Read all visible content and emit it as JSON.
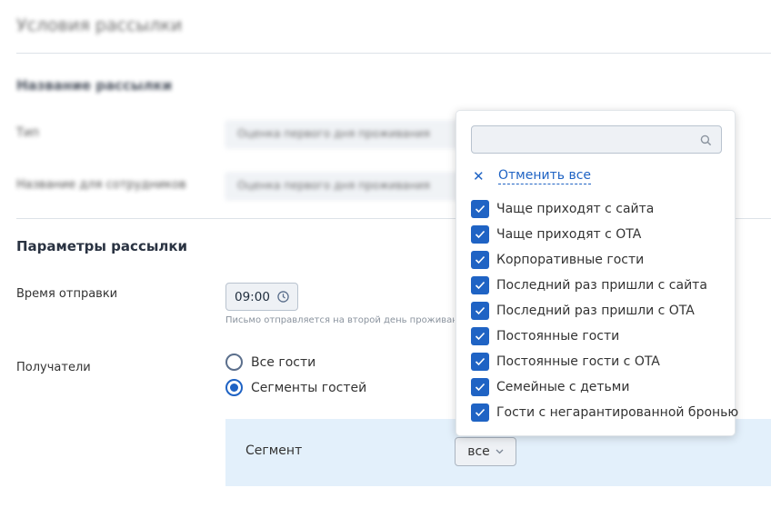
{
  "page": {
    "title": "Условия рассылки"
  },
  "name_section": {
    "heading": "Название рассылки",
    "type_label": "Тип",
    "type_value": "Оценка первого дня проживания",
    "staff_label": "Название для сотрудников",
    "staff_value": "Оценка первого дня проживания"
  },
  "params": {
    "heading": "Параметры рассылки",
    "time_label": "Время отправки",
    "time_value": "09:00",
    "time_hint": "Письмо отправляется на второй день проживания гостя",
    "recipients_label": "Получатели",
    "radio_all": "Все гости",
    "radio_segments": "Сегменты гостей",
    "segment_label": "Сегмент",
    "segment_value": "все"
  },
  "dropdown": {
    "search_placeholder": "",
    "cancel_all": "Отменить все",
    "items": [
      {
        "label": "Чаще приходят с сайта",
        "checked": true
      },
      {
        "label": "Чаще приходят с OTA",
        "checked": true
      },
      {
        "label": "Корпоративные гости",
        "checked": true
      },
      {
        "label": "Последний раз пришли с сайта",
        "checked": true
      },
      {
        "label": "Последний раз пришли с OTA",
        "checked": true
      },
      {
        "label": "Постоянные гости",
        "checked": true
      },
      {
        "label": "Постоянные гости с OTA",
        "checked": true
      },
      {
        "label": "Семейные с детьми",
        "checked": true
      },
      {
        "label": "Гости с негарантированной бронью",
        "checked": true
      }
    ]
  },
  "colors": {
    "accent": "#1f63c4",
    "panel": "#e3f0fb"
  }
}
